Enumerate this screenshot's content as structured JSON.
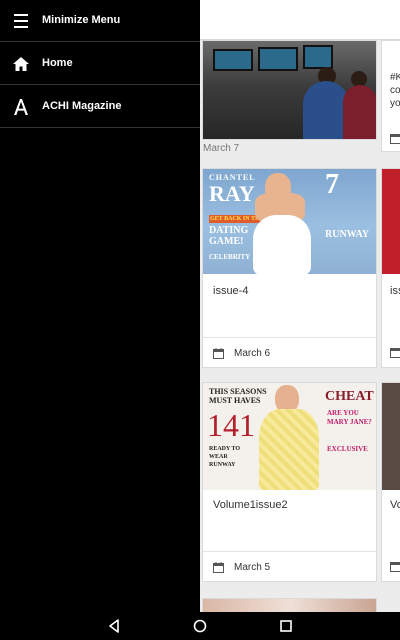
{
  "drawer": {
    "items": [
      {
        "label": "Minimize Menu",
        "icon": "hamburger-icon"
      },
      {
        "label": "Home",
        "icon": "home-icon"
      },
      {
        "label": "ACHI Magazine",
        "icon": "a-letter-icon"
      }
    ]
  },
  "feed": {
    "top_card": {
      "date": "March 7",
      "side_text": "#K co yo"
    },
    "cards": [
      {
        "title": "issue-4",
        "date": "March 6",
        "cover": {
          "line1": "CHANTEL",
          "line2": "RAY",
          "num": "7",
          "tag1": "GET BACK IN THE",
          "tag2": "DATING GAME!",
          "tag3": "CELEBRITY",
          "tag4": "RUNWAY"
        }
      },
      {
        "title": "Volume1issue2",
        "date": "March 5",
        "cover": {
          "line1": "THIS SEASONS",
          "line2": "MUST HAVES",
          "num": "141",
          "tag1": "READY TO WEAR RUNWAY",
          "tag2": "CHEAT",
          "tag3": "EXCLUSIVE",
          "tag4": "ARE YOU MARY JANE?"
        }
      }
    ],
    "right_cards": [
      {
        "title": "iss"
      },
      {
        "title": "Vo"
      }
    ]
  },
  "system_nav": {
    "back": "back-icon",
    "home": "home-circle-icon",
    "recents": "recents-icon"
  },
  "colors": {
    "drawer_bg": "#000000",
    "content_bg": "#ececec",
    "card_bg": "#ffffff"
  }
}
